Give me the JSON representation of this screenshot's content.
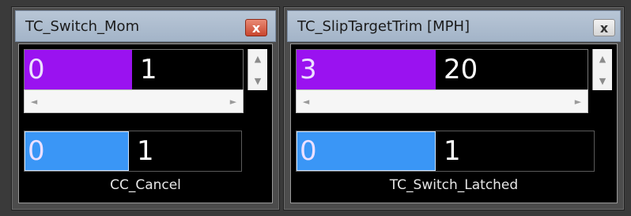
{
  "windows": [
    {
      "title": "TC_Switch_Mom",
      "close_glyph": "x",
      "close_style": "red",
      "control1": {
        "left_value": "0",
        "right_value": "1",
        "fill_fraction": 0.5,
        "fill_color": "#9a12f0"
      },
      "control2": {
        "left_value": "0",
        "right_value": "1",
        "fill_fraction": 0.5,
        "fill_color": "#3a96f6"
      },
      "caption": "CC_Cancel"
    },
    {
      "title": "TC_SlipTargetTrim [MPH]",
      "close_glyph": "x",
      "close_style": "gray",
      "control1": {
        "left_value": "3",
        "right_value": "20",
        "fill_fraction": 0.47,
        "fill_color": "#9a12f0"
      },
      "control2": {
        "left_value": "0",
        "right_value": "1",
        "fill_fraction": 0.47,
        "fill_color": "#3a96f6"
      },
      "caption": "TC_Switch_Latched"
    }
  ],
  "icons": {
    "scroll_up": "▲",
    "scroll_down": "▼",
    "scroll_left": "◄",
    "scroll_right": "►"
  }
}
